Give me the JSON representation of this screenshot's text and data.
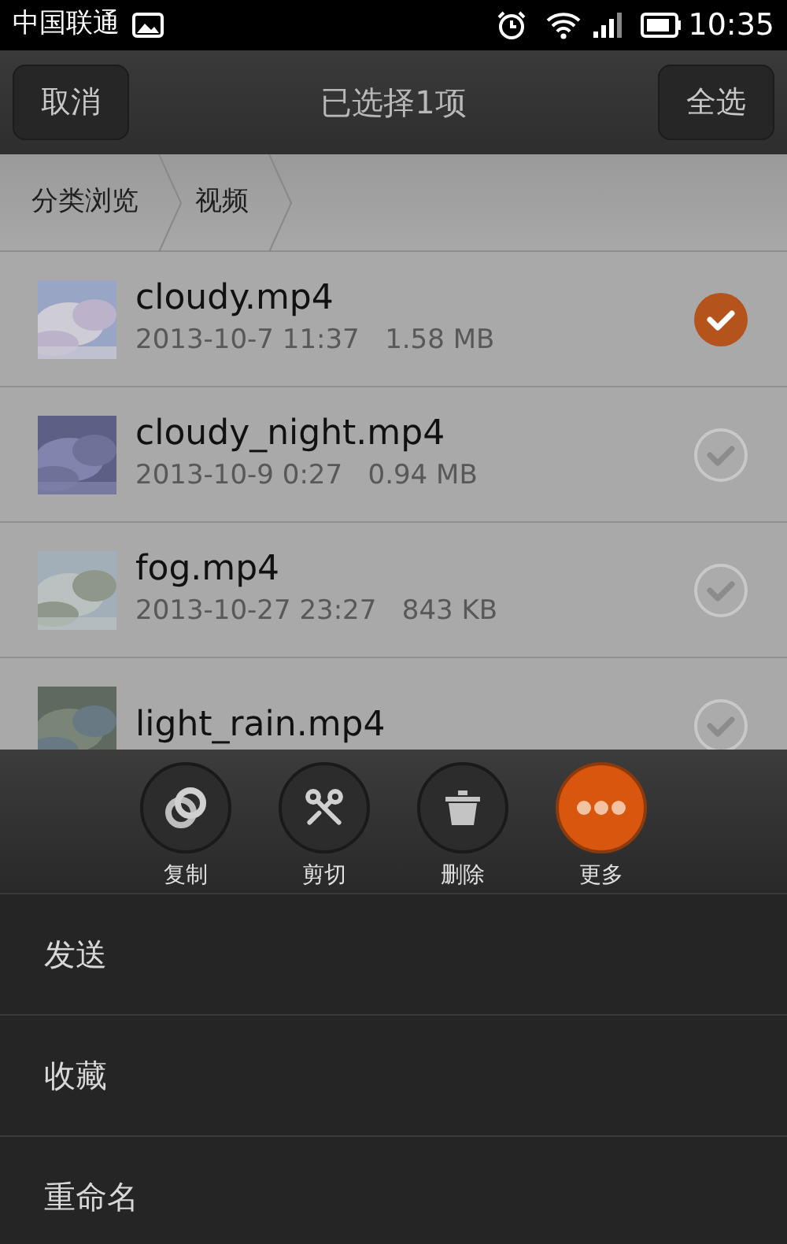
{
  "status_bar": {
    "carrier": "中国联通",
    "time": "10:35"
  },
  "header": {
    "cancel": "取消",
    "title": "已选择1项",
    "select_all": "全选"
  },
  "breadcrumb": [
    "分类浏览",
    "视频"
  ],
  "files": [
    {
      "name": "cloudy.mp4",
      "meta": "2013-10-7 11:37   1.58 MB",
      "selected": true
    },
    {
      "name": "cloudy_night.mp4",
      "meta": "2013-10-9 0:27   0.94 MB",
      "selected": false
    },
    {
      "name": "fog.mp4",
      "meta": "2013-10-27 23:27   843 KB",
      "selected": false
    },
    {
      "name": "light_rain.mp4",
      "selected": false
    }
  ],
  "actions": [
    {
      "label": "复制",
      "kind": "copy"
    },
    {
      "label": "剪切",
      "kind": "cut"
    },
    {
      "label": "删除",
      "kind": "delete"
    },
    {
      "label": "更多",
      "kind": "more"
    }
  ],
  "menu": [
    "发送",
    "收藏",
    "重命名"
  ]
}
